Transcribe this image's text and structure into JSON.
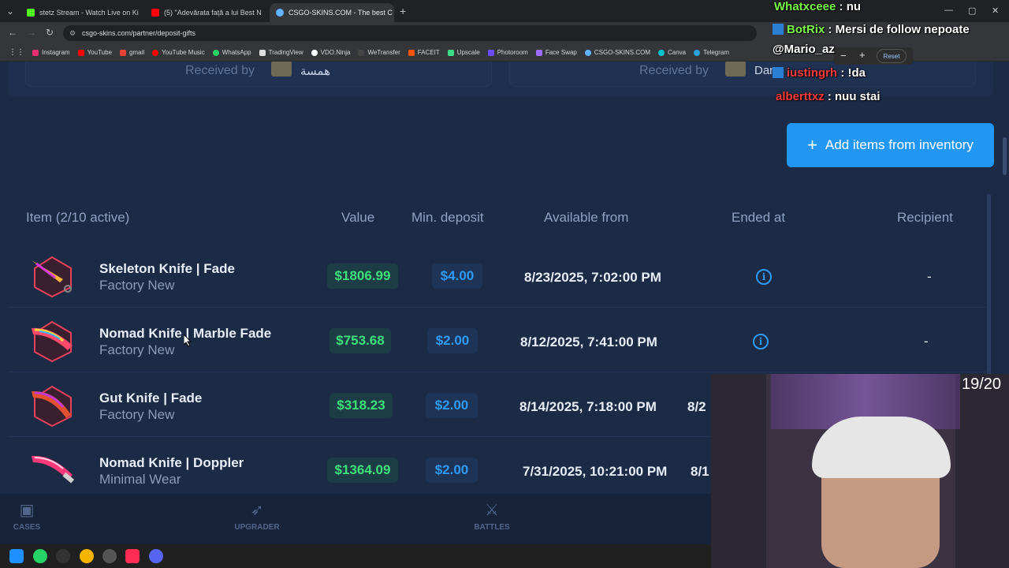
{
  "browser": {
    "tabs": [
      {
        "title": "stetz Stream - Watch Live on Ki",
        "color": "#53fc18"
      },
      {
        "title": "(5) \"Adevărata față a lui Best N",
        "color": "#ff0000"
      },
      {
        "title": "CSGO-SKINS.COM - The best C",
        "color": "#5fb3ff"
      }
    ],
    "url": "csgo-skins.com/partner/deposit-gifts",
    "bookmarks": [
      {
        "label": "Instagram",
        "color": "#e1306c"
      },
      {
        "label": "YouTube",
        "color": "#ff0000"
      },
      {
        "label": "gmail",
        "color": "#ea4335"
      },
      {
        "label": "YouTube Music",
        "color": "#ff0000"
      },
      {
        "label": "WhatsApp",
        "color": "#25d366"
      },
      {
        "label": "TradingView",
        "color": "#dddddd"
      },
      {
        "label": "VDO.Ninja",
        "color": "#ffffff"
      },
      {
        "label": "WeTransfer",
        "color": "#444444"
      },
      {
        "label": "FACEIT",
        "color": "#ff5500"
      },
      {
        "label": "Upscale",
        "color": "#3ddc84"
      },
      {
        "label": "Photoroom",
        "color": "#6b4dff"
      },
      {
        "label": "Face Swap",
        "color": "#9c6bff"
      },
      {
        "label": "CSGO-SKINS.COM",
        "color": "#5fb3ff"
      },
      {
        "label": "Canva",
        "color": "#00c4cc"
      },
      {
        "label": "Telegram",
        "color": "#2aa1da"
      }
    ]
  },
  "received_cards": [
    {
      "label": "Received by",
      "name": "همسة"
    },
    {
      "label": "Received by",
      "name": "Dan"
    }
  ],
  "add_button_label": "Add items from inventory",
  "table": {
    "headers": {
      "item": "Item (2/10 active)",
      "value": "Value",
      "min_deposit": "Min. deposit",
      "available_from": "Available from",
      "ended_at": "Ended at",
      "recipient": "Recipient"
    },
    "rows": [
      {
        "name": "Skeleton Knife | Fade",
        "wear": "Factory New",
        "value": "$1806.99",
        "min": "$4.00",
        "available": "8/23/2025, 7:02:00 PM",
        "ended": "info",
        "recipient": "-"
      },
      {
        "name": "Nomad Knife | Marble Fade",
        "wear": "Factory New",
        "value": "$753.68",
        "min": "$2.00",
        "available": "8/12/2025, 7:41:00 PM",
        "ended": "info",
        "recipient": "-"
      },
      {
        "name": "Gut Knife | Fade",
        "wear": "Factory New",
        "value": "$318.23",
        "min": "$2.00",
        "available": "8/14/2025, 7:18:00 PM",
        "ended": "8/2",
        "recipient": ""
      },
      {
        "name": "Nomad Knife | Doppler",
        "wear": "Minimal Wear",
        "value": "$1364.09",
        "min": "$2.00",
        "available": "7/31/2025, 10:21:00 PM",
        "ended": "8/1",
        "recipient": ""
      }
    ]
  },
  "bottom_nav": [
    {
      "label": "CASES",
      "icon": "cases-icon"
    },
    {
      "label": "UPGRADER",
      "icon": "rocket-icon"
    },
    {
      "label": "BATTLES",
      "icon": "swords-icon"
    }
  ],
  "overlay": {
    "counter": "19/20",
    "zoom_reset": "Reset",
    "chat": [
      {
        "user": "Whatxceee",
        "msg": ": nu",
        "color": "#7cfc4a"
      },
      {
        "user": "BotRix",
        "msg": ": Mersi de follow nepoate",
        "color": "#7cfc4a"
      },
      {
        "user": "@Mario_az",
        "msg": "",
        "color": "#ffffff"
      },
      {
        "user": "iustingrh",
        "msg": ": !da",
        "color": "#ff3b3b"
      },
      {
        "user": "alberttxz",
        "msg": ": nuu stai",
        "color": "#ff3b3b"
      }
    ]
  }
}
